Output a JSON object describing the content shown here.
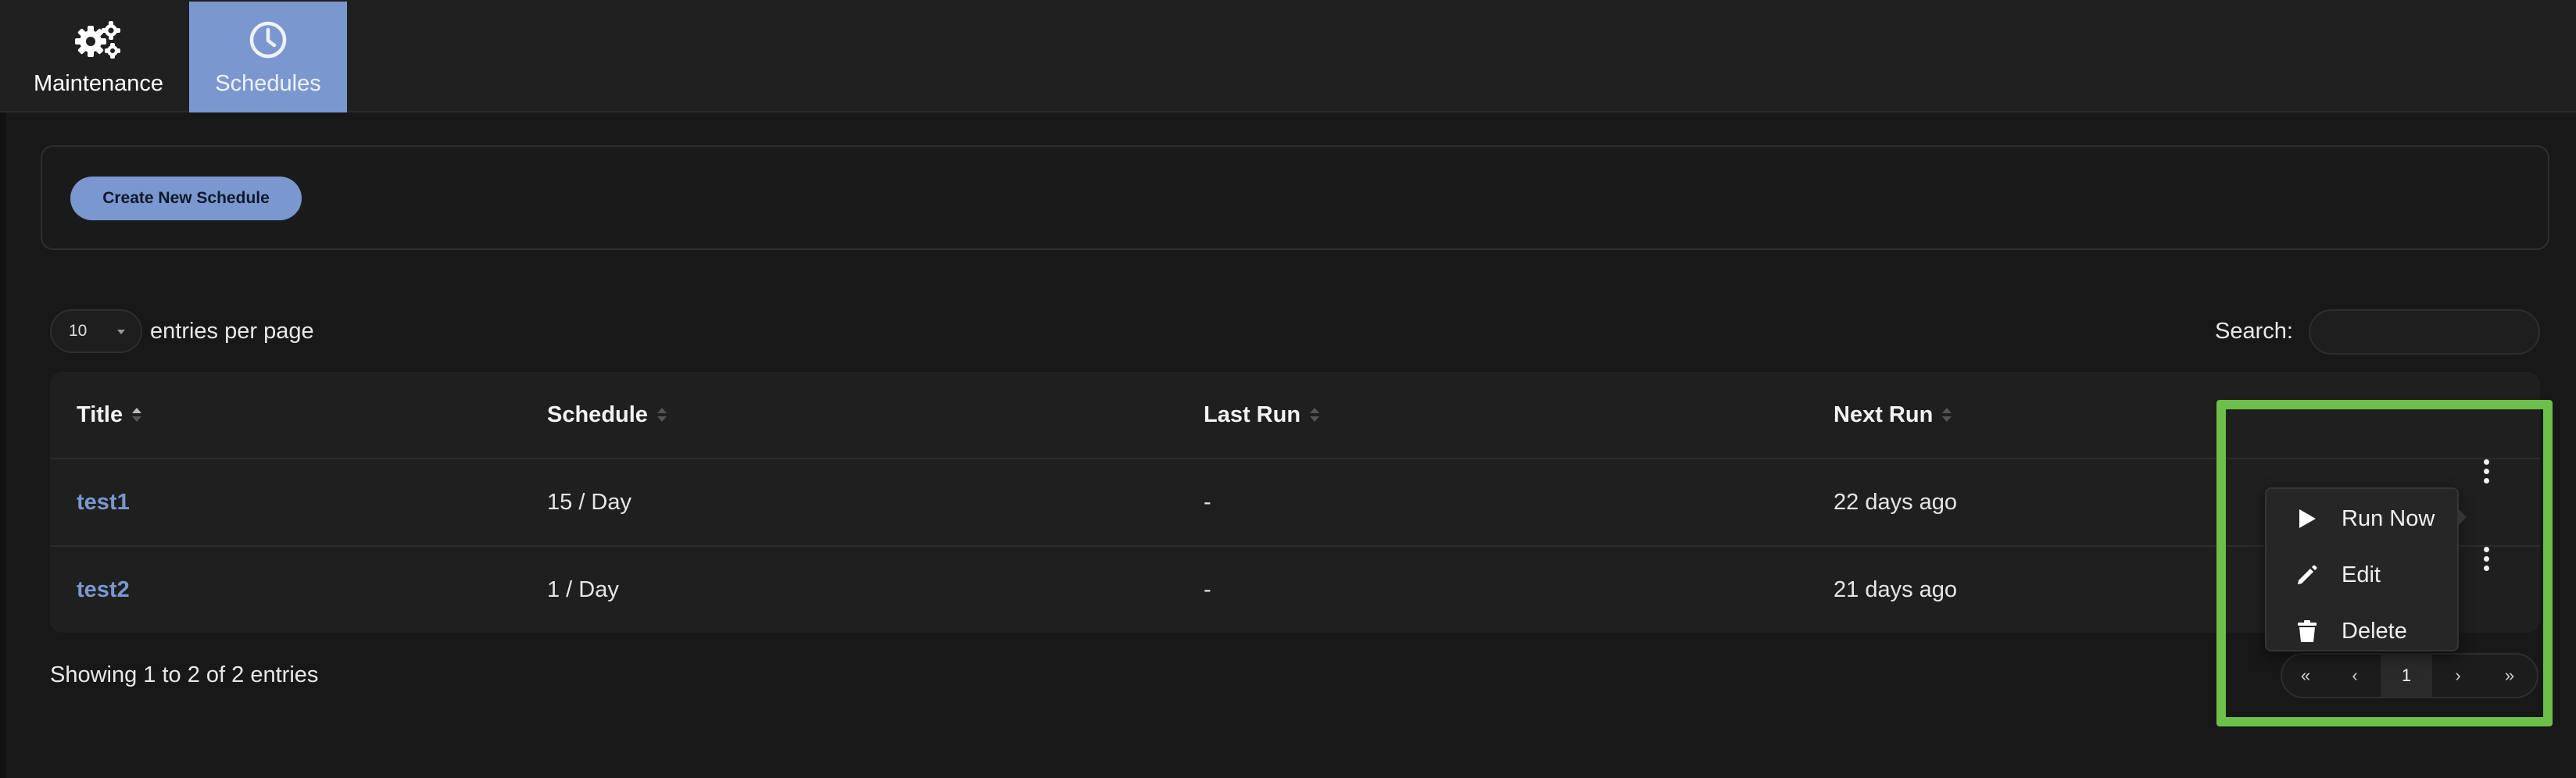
{
  "nav": {
    "tabs": [
      {
        "label": "Maintenance",
        "icon": "gears-icon",
        "active": false
      },
      {
        "label": "Schedules",
        "icon": "clock-icon",
        "active": true
      }
    ]
  },
  "actions": {
    "create_label": "Create New Schedule"
  },
  "controls": {
    "page_size": "10",
    "entries_per_page_label": "entries per page",
    "search_label": "Search:",
    "search_value": ""
  },
  "table": {
    "headers": [
      "Title",
      "Schedule",
      "Last Run",
      "Next Run"
    ],
    "rows": [
      {
        "title": "test1",
        "schedule": "15 / Day",
        "last_run": "-",
        "next_run": "22 days ago"
      },
      {
        "title": "test2",
        "schedule": "1 / Day",
        "last_run": "-",
        "next_run": "21 days ago"
      }
    ]
  },
  "footer": {
    "info": "Showing 1 to 2 of 2 entries"
  },
  "pagination": {
    "first": "«",
    "prev": "‹",
    "current": "1",
    "next": "›",
    "last": "»"
  },
  "row_menu": {
    "items": [
      {
        "label": "Run Now",
        "icon": "play-icon"
      },
      {
        "label": "Edit",
        "icon": "pencil-icon"
      },
      {
        "label": "Delete",
        "icon": "trash-icon"
      }
    ]
  },
  "colors": {
    "accent": "#7a98cf",
    "background": "#181818",
    "highlight": "#6cc04a"
  }
}
